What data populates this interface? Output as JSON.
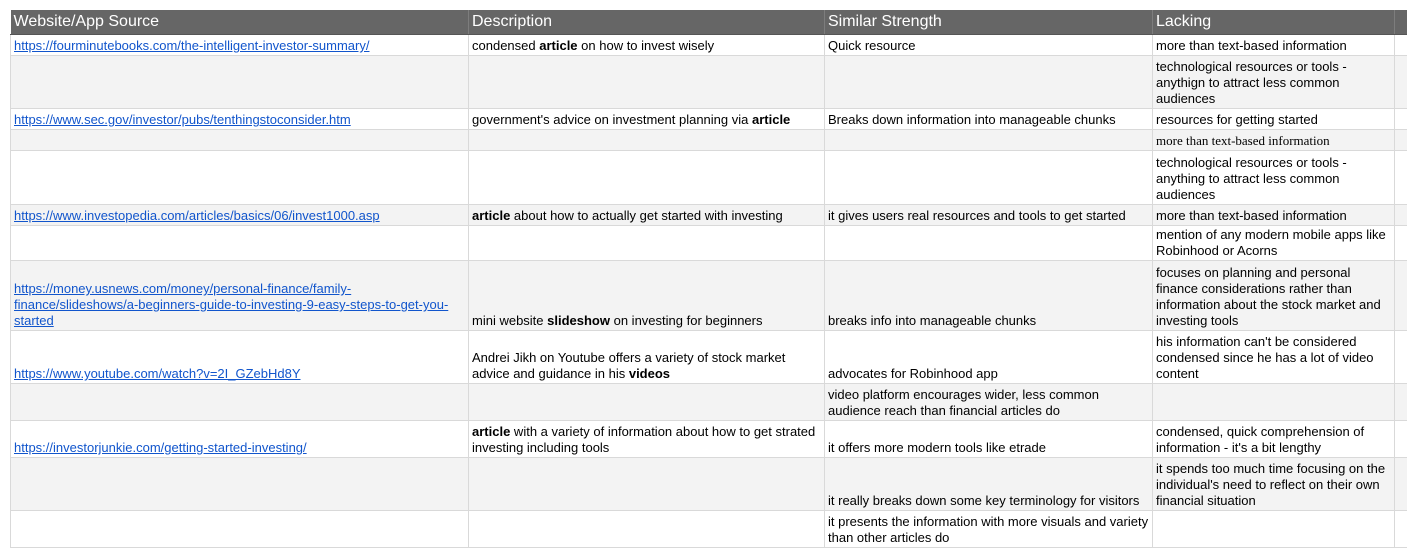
{
  "header": {
    "source": "Website/App Source",
    "description": "Description",
    "strength": "Similar Strength",
    "lacking": "Lacking"
  },
  "rows": [
    {
      "link": "https://fourminutebooks.com/the-intelligent-investor-summary/",
      "desc_pre": "condensed ",
      "desc_bold": "article",
      "desc_post": " on how to invest wisely",
      "strength": "Quick resource",
      "lacking": "more than text-based information"
    },
    {
      "link": "",
      "desc_pre": "",
      "desc_bold": "",
      "desc_post": "",
      "strength": "",
      "lacking": "technological resources or tools - anythign to attract less common audiences"
    },
    {
      "link": "https://www.sec.gov/investor/pubs/tenthingstoconsider.htm",
      "desc_pre": "government's advice on investment planning via ",
      "desc_bold": "article",
      "desc_post": "",
      "strength": "Breaks down information into manageable chunks",
      "lacking": "resources for getting started"
    },
    {
      "link": "",
      "desc_pre": "",
      "desc_bold": "",
      "desc_post": "",
      "strength": "",
      "lacking": "more than text-based information"
    },
    {
      "link": "",
      "desc_pre": "",
      "desc_bold": "",
      "desc_post": "",
      "strength": "",
      "lacking": "technological resources or tools - anything to attract less common audiences"
    },
    {
      "link": "https://www.investopedia.com/articles/basics/06/invest1000.asp",
      "desc_pre": "",
      "desc_bold": "article",
      "desc_post": " about how to actually get started with investing",
      "strength": "it gives users real resources and tools to get started",
      "lacking": "more than text-based information"
    },
    {
      "link": "",
      "desc_pre": "",
      "desc_bold": "",
      "desc_post": "",
      "strength": "",
      "lacking": "mention of any modern mobile apps like Robinhood or Acorns"
    },
    {
      "link": "https://money.usnews.com/money/personal-finance/family-finance/slideshows/a-beginners-guide-to-investing-9-easy-steps-to-get-you-started",
      "desc_pre": "mini website ",
      "desc_bold": "slideshow",
      "desc_post": " on investing for beginners",
      "strength": "breaks info into manageable chunks",
      "lacking": "focuses on planning and personal finance considerations rather than information about the stock market and investing tools"
    },
    {
      "link": "https://www.youtube.com/watch?v=2I_GZebHd8Y",
      "desc_pre": "Andrei Jikh on Youtube offers a variety of stock market advice and guidance in his ",
      "desc_bold": "videos",
      "desc_post": "",
      "strength": "advocates for Robinhood app",
      "lacking": "his information can't be considered condensed since he has a lot of video content"
    },
    {
      "link": "",
      "desc_pre": "",
      "desc_bold": "",
      "desc_post": "",
      "strength": "video platform encourages wider, less common audience reach than financial articles do",
      "lacking": ""
    },
    {
      "link": "https://investorjunkie.com/getting-started-investing/",
      "desc_pre": "",
      "desc_bold": "article",
      "desc_post": " with a variety of information about how to get strated investing including tools",
      "strength": "it offers more modern tools like etrade",
      "lacking": "condensed, quick comprehension of information - it's a bit lengthy"
    },
    {
      "link": "",
      "desc_pre": "",
      "desc_bold": "",
      "desc_post": "",
      "strength": "it really breaks down some key terminology for visitors",
      "lacking": "it spends too much time focusing on the individual's need to reflect on their own financial situation"
    },
    {
      "link": "",
      "desc_pre": "",
      "desc_bold": "",
      "desc_post": "",
      "strength": "it presents the information with more visuals and variety than other articles do",
      "lacking": ""
    }
  ]
}
